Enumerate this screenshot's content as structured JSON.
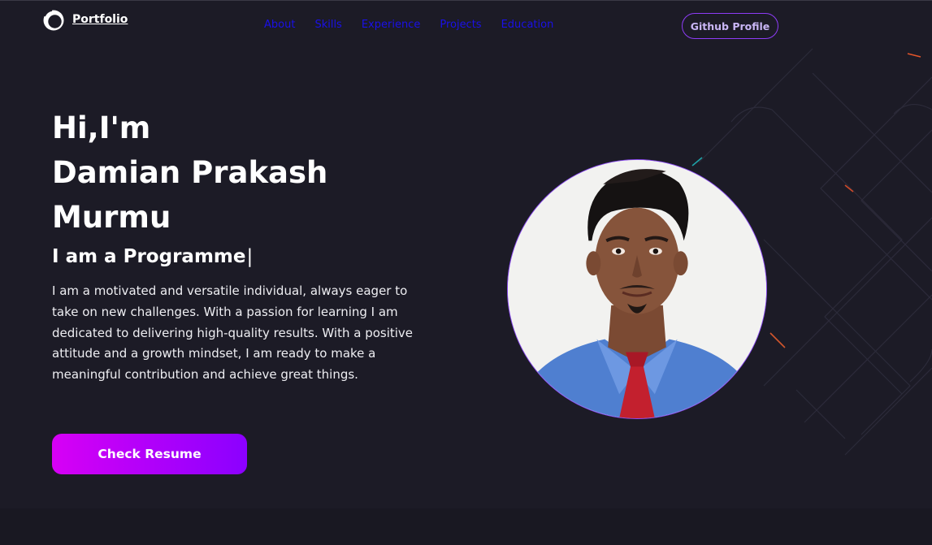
{
  "brand": {
    "name": "Portfolio",
    "icon": "logo-ring-icon"
  },
  "nav": {
    "items": [
      {
        "label": "About"
      },
      {
        "label": "Skills"
      },
      {
        "label": "Experience"
      },
      {
        "label": "Projects"
      },
      {
        "label": "Education"
      }
    ],
    "github_label": "Github Profile"
  },
  "hero": {
    "greeting": "Hi,I'm",
    "name_line1": "Damian Prakash",
    "name_line2": "Murmu",
    "role_prefix": "I am a",
    "role_typed": "Programme",
    "cursor": "|",
    "bio": "I am a motivated and versatile individual, always eager to take on new challenges. With a passion for learning I am dedicated to delivering high-quality results. With a positive attitude and a growth mindset, I am ready to make a meaningful contribution and achieve great things.",
    "resume_label": "Check Resume"
  },
  "colors": {
    "background": "#1c1b26",
    "nav_link": "#1a10e8",
    "accent_start": "#d700f5",
    "accent_end": "#8b00ff",
    "outline": "#8e3cf7"
  }
}
